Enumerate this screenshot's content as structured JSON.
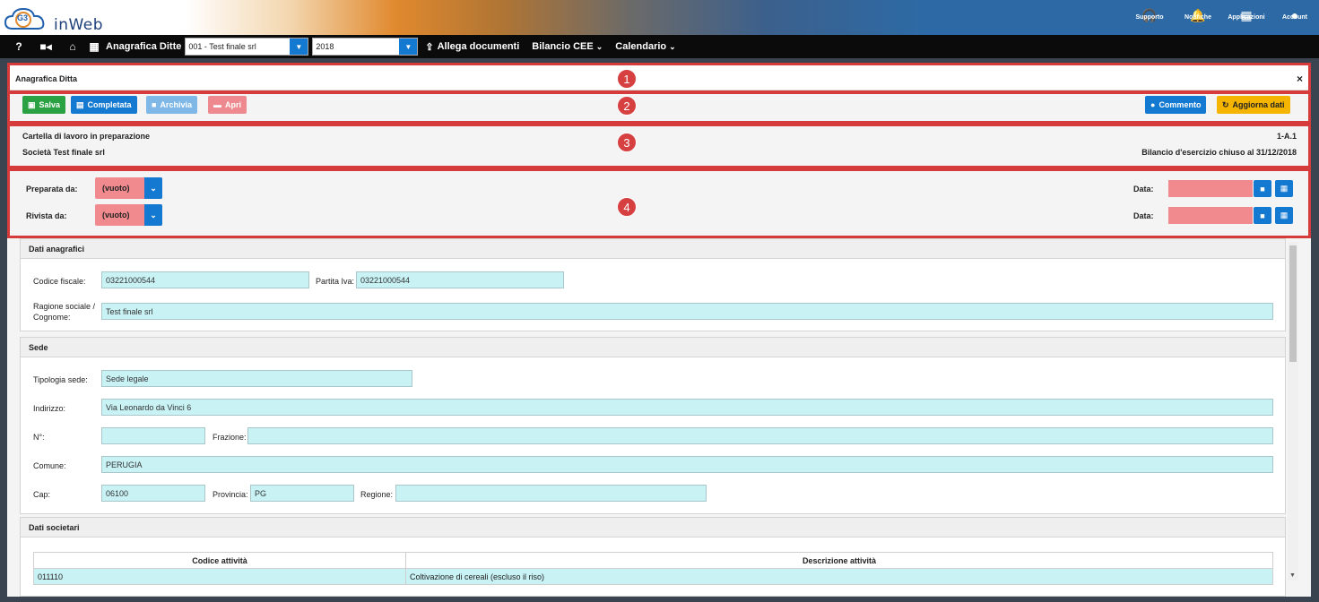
{
  "app": {
    "logo_text": "inWeb",
    "logo_mark": "G3"
  },
  "top_icons": [
    {
      "icon": "headset-icon",
      "glyph": "🎧",
      "label": "Supporto"
    },
    {
      "icon": "bell-icon",
      "glyph": "🔔",
      "label": "Notifiche"
    },
    {
      "icon": "grid-icon",
      "glyph": "▦",
      "label": "Applicazioni"
    },
    {
      "icon": "account-icon",
      "glyph": "●",
      "label": "Account"
    }
  ],
  "nav": {
    "help": "?",
    "anagrafica_label": "Anagrafica Ditte",
    "company_select": "001 - Test finale srl",
    "year_select": "2018",
    "allega": "Allega documenti",
    "bilancio": "Bilancio CEE",
    "calendario": "Calendario"
  },
  "annotations": [
    "1",
    "2",
    "3",
    "4"
  ],
  "panel": {
    "title": "Anagrafica Ditta",
    "close": "×"
  },
  "toolbar": {
    "salva": "Salva",
    "completata": "Completata",
    "archivia": "Archivia",
    "apri": "Apri",
    "commento": "Commento",
    "aggiorna": "Aggiorna dati"
  },
  "info": {
    "status": "Cartella di lavoro in preparazione",
    "code": "1-A.1",
    "company": "Società Test finale srl",
    "bilancio": "Bilancio d'esercizio chiuso al 31/12/2018"
  },
  "review": {
    "preparata_label": "Preparata da:",
    "preparata_value": "(vuoto)",
    "rivista_label": "Rivista da:",
    "rivista_value": "(vuoto)",
    "data_label": "Data:"
  },
  "dati_anagrafici": {
    "title": "Dati anagrafici",
    "cf_label": "Codice fiscale:",
    "cf_value": "03221000544",
    "piva_label": "Partita Iva:",
    "piva_value": "03221000544",
    "ragione_label_1": "Ragione sociale /",
    "ragione_label_2": "Cognome:",
    "ragione_value": "Test finale srl"
  },
  "sede": {
    "title": "Sede",
    "tipologia_label": "Tipologia sede:",
    "tipologia_value": "Sede legale",
    "indirizzo_label": "Indirizzo:",
    "indirizzo_value": "Via Leonardo da Vinci 6",
    "numero_label": "N°:",
    "numero_value": "",
    "frazione_label": "Frazione:",
    "frazione_value": "",
    "comune_label": "Comune:",
    "comune_value": "PERUGIA",
    "cap_label": "Cap:",
    "cap_value": "06100",
    "provincia_label": "Provincia:",
    "provincia_value": "PG",
    "regione_label": "Regione:",
    "regione_value": ""
  },
  "dati_societari": {
    "title": "Dati societari",
    "columns": [
      "Codice attività",
      "Descrizione attività"
    ],
    "rows": [
      [
        "011110",
        "Coltivazione di cereali (escluso il riso)"
      ]
    ]
  }
}
